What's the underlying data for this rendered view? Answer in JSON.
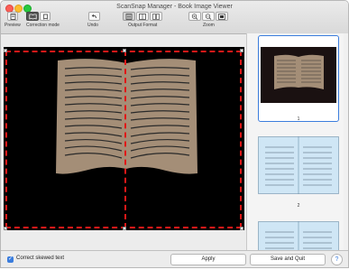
{
  "window": {
    "title": "ScanSnap Manager - Book Image Viewer"
  },
  "toolbar": {
    "preview_label": "Preview",
    "correction_mode_label": "Correction mode",
    "undo_label": "Undo",
    "output_format_label": "Output Format",
    "zoom_label": "Zoom"
  },
  "sidebar": {
    "pages": [
      {
        "label": "1",
        "selected": true
      },
      {
        "label": "2",
        "selected": false
      }
    ]
  },
  "bottom": {
    "checkbox_label": "Correct skewed text",
    "checkbox_checked": true,
    "apply_label": "Apply",
    "save_quit_label": "Save and Quit",
    "help_label": "?"
  },
  "colors": {
    "accent": "#3b7ddd",
    "dash_red": "#e01818",
    "book_page": "#a48e77",
    "thumb_blue": "#cfe6f5"
  }
}
